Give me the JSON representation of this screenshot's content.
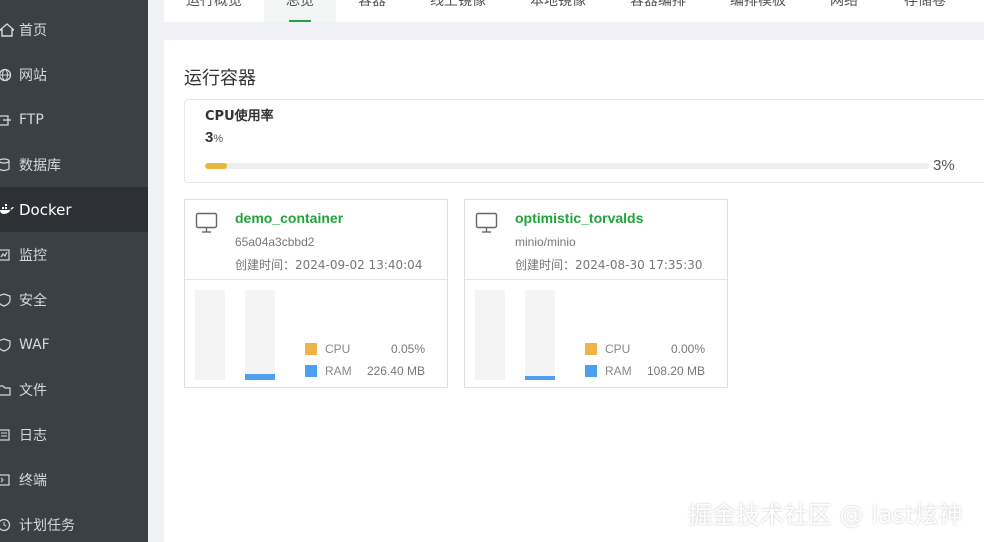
{
  "sidebar": {
    "items": [
      {
        "label": "首页",
        "icon": "home-icon"
      },
      {
        "label": "网站",
        "icon": "globe-icon"
      },
      {
        "label": "FTP",
        "icon": "ftp-icon"
      },
      {
        "label": "数据库",
        "icon": "database-icon"
      },
      {
        "label": "Docker",
        "icon": "docker-icon",
        "active": true
      },
      {
        "label": "监控",
        "icon": "monitor-chart-icon"
      },
      {
        "label": "安全",
        "icon": "shield-icon"
      },
      {
        "label": "WAF",
        "icon": "waf-icon"
      },
      {
        "label": "文件",
        "icon": "folder-icon"
      },
      {
        "label": "日志",
        "icon": "log-icon"
      },
      {
        "label": "终端",
        "icon": "terminal-icon"
      },
      {
        "label": "计划任务",
        "icon": "clock-icon"
      }
    ]
  },
  "tabs": {
    "items": [
      {
        "label": "运行概览"
      },
      {
        "label": "总览",
        "active": true
      },
      {
        "label": "容器"
      },
      {
        "label": "线上镜像"
      },
      {
        "label": "本地镜像"
      },
      {
        "label": "容器编排"
      },
      {
        "label": "编排模板"
      },
      {
        "label": "网络"
      },
      {
        "label": "存储卷"
      }
    ]
  },
  "section": {
    "title": "运行容器"
  },
  "cpu": {
    "title": "CPU使用率",
    "value": "3",
    "unit": "%",
    "percent_label": "3%",
    "percent": 3
  },
  "containers": [
    {
      "name": "demo_container",
      "image": "65a04a3cbbd2",
      "created": "创建时间：2024-09-02 13:40:04",
      "cpu_label": "CPU",
      "cpu_value": "0.05%",
      "cpu_fraction": 0.0005,
      "ram_label": "RAM",
      "ram_value": "226.40 MB",
      "ram_fraction": 0.07
    },
    {
      "name": "optimistic_torvalds",
      "image": "minio/minio",
      "created": "创建时间：2024-08-30 17:35:30",
      "cpu_label": "CPU",
      "cpu_value": "0.00%",
      "cpu_fraction": 0.0,
      "ram_label": "RAM",
      "ram_value": "108.20 MB",
      "ram_fraction": 0.04
    }
  ],
  "colors": {
    "accent": "#20a53a",
    "cpu_bar": "#ebb53d",
    "cpu_legend": "#f0b34a",
    "ram": "#4f9ff0",
    "sidebar": "#3b4045",
    "sidebar_active": "#2d3135"
  },
  "watermark": "掘金技术社区 @ last炫神"
}
